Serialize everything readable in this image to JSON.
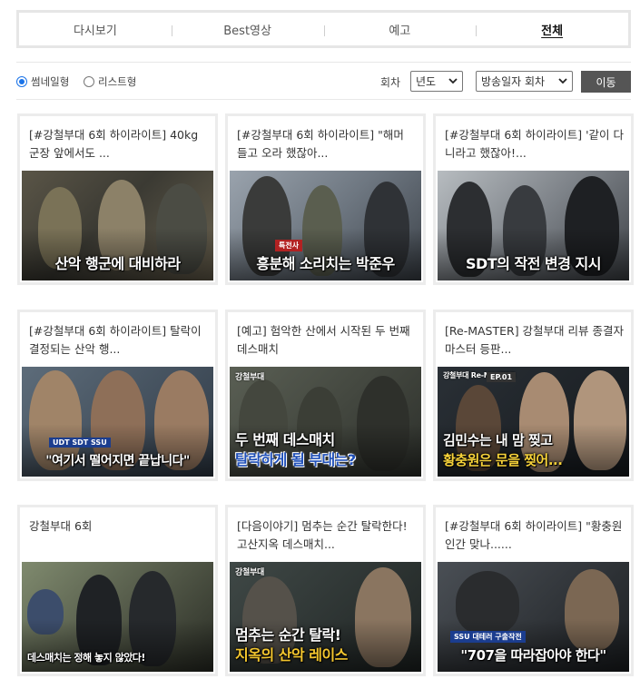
{
  "tabs": [
    {
      "label": "다시보기",
      "active": false
    },
    {
      "label": "Best영상",
      "active": false
    },
    {
      "label": "예고",
      "active": false
    },
    {
      "label": "전체",
      "active": true
    }
  ],
  "view_options": {
    "thumbnail_label": "썸네일형",
    "list_label": "리스트형",
    "selected": "thumbnail"
  },
  "filter": {
    "round_label": "회차",
    "year_select": "년도",
    "date_select": "방송일자 회차",
    "go_button": "이동"
  },
  "cards": [
    {
      "title": "[#강철부대 6회 하이라이트] 40kg 군장 앞에서도 ...",
      "caption": "산악 행군에 대비하라",
      "caption_top": "",
      "tag": "",
      "logo": ""
    },
    {
      "title": "[#강철부대 6회 하이라이트] \"해머 들고 오라 했잖아...",
      "caption": "흥분해 소리치는 박준우",
      "caption_top": "",
      "tag": "특전사",
      "logo": ""
    },
    {
      "title": "[#강철부대 6회 하이라이트] '같이 다니라고 했잖아!...",
      "caption": "SDT의 작전 변경 지시",
      "caption_top": "",
      "tag": "",
      "logo": ""
    },
    {
      "title": "[#강철부대 6회 하이라이트] 탈락이 결정되는 산악 행...",
      "caption": "\"여기서 떨어지면 끝납니다\"",
      "caption_top": "",
      "tag": "UDT  SDT  SSU",
      "logo": ""
    },
    {
      "title": "[예고] 험악한 산에서 시작된 두 번째 데스매치",
      "caption": "탈락하게 될 부대는?",
      "caption_top": "두 번째 데스매치",
      "tag": "",
      "logo": "강철부대"
    },
    {
      "title": "[Re-MASTER] 강철부대 리뷰 종결자 마스터 등판...",
      "caption": "황충원은 문을 찢어...",
      "caption_top": "김민수는 내 맘 찢고",
      "tag": "EP.01",
      "logo": "강철부대 Re-MASTER"
    },
    {
      "title": "강철부대 6회",
      "caption": "데스매치는 정해 놓지 않았다!",
      "caption_top": "",
      "tag": "",
      "logo": ""
    },
    {
      "title": "[다음이야기] 멈추는 순간 탈락한다! 고산지옥 데스매치...",
      "caption": "지옥의 산악 레이스",
      "caption_top": "멈추는 순간 탈락!",
      "tag": "",
      "logo": "강철부대"
    },
    {
      "title": "[#강철부대 6회 하이라이트] \"황충원 인간 맞나......",
      "caption": "\"707을 따라잡아야 한다\"",
      "caption_top": "",
      "tag": "SSU 대테러 구출작전",
      "logo": ""
    }
  ],
  "colors": {
    "accent": "#1a73e8",
    "go_button_bg": "#555555",
    "border": "#ececec"
  }
}
